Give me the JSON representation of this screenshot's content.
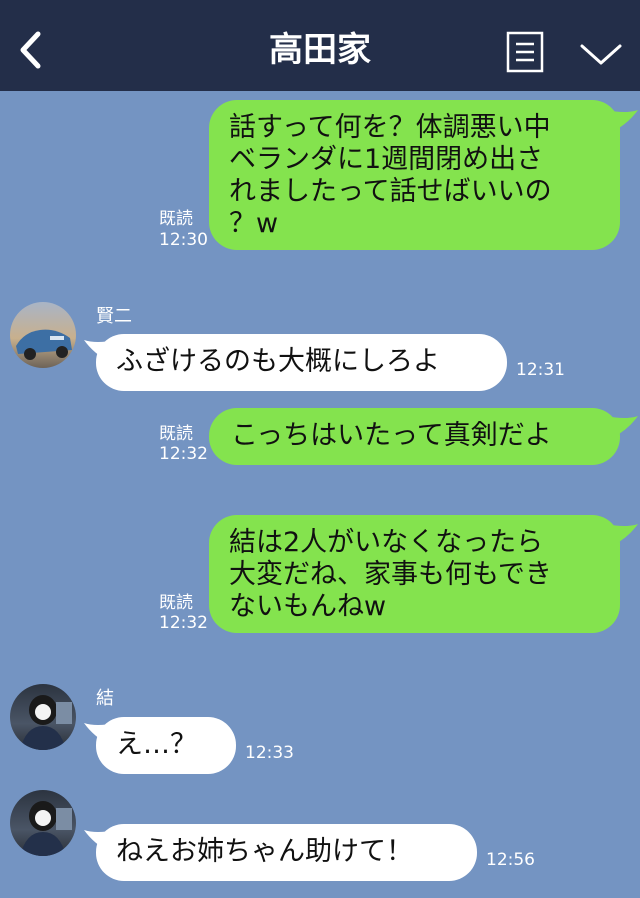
{
  "header": {
    "title": "高田家",
    "back_icon": "chevron-left-icon",
    "menu_icon": "list-menu-icon",
    "dropdown_icon": "chevron-down-icon",
    "bg_color": "#232e49"
  },
  "chat": {
    "bg_color": "#7494c2",
    "out_bubble_color": "#84e34e",
    "in_bubble_color": "#ffffff",
    "messages": [
      {
        "side": "out",
        "text": "話すって何を？体調悪い中\nベランダに1週間閉め出さ\nれましたって話せばいいの\n？w",
        "read": "既読",
        "time": "12:30"
      },
      {
        "side": "in",
        "sender": "賢二",
        "text": "ふざけるのも大概にしろよ",
        "time": "12:31"
      },
      {
        "side": "out",
        "text": "こっちはいたって真剣だよ",
        "read": "既読",
        "time": "12:32"
      },
      {
        "side": "out",
        "text": "結は2人がいなくなったら\n大変だね、家事も何もでき\nないもんねw",
        "read": "既読",
        "time": "12:32"
      },
      {
        "side": "in",
        "sender": "結",
        "text": "え…？",
        "time": "12:33"
      },
      {
        "side": "in",
        "sender": "",
        "text": "ねえお姉ちゃん助けて！",
        "time": "12:56"
      }
    ]
  }
}
